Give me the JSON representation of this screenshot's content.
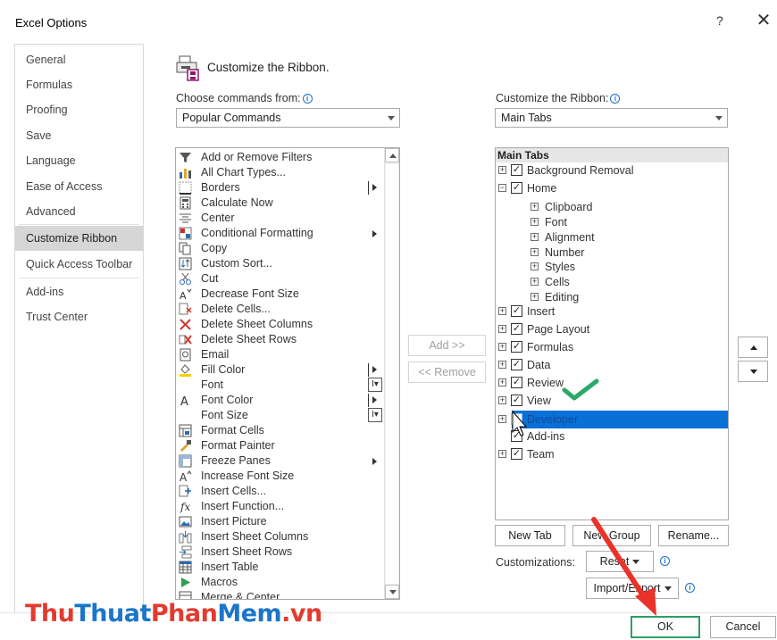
{
  "window": {
    "title": "Excel Options",
    "help": "?",
    "close": "✕"
  },
  "nav": {
    "items": [
      "General",
      "Formulas",
      "Proofing",
      "Save",
      "Language",
      "Ease of Access",
      "Advanced",
      "Customize Ribbon",
      "Quick Access Toolbar",
      "Add-ins",
      "Trust Center"
    ],
    "active": "Customize Ribbon"
  },
  "main": {
    "header": "Customize the Ribbon.",
    "choose_label": "Choose commands from:",
    "choose_value": "Popular Commands",
    "customize_label": "Customize the Ribbon:",
    "customize_value": "Main Tabs"
  },
  "commands": [
    "Add or Remove Filters",
    "All Chart Types...",
    "Borders",
    "Calculate Now",
    "Center",
    "Conditional Formatting",
    "Copy",
    "Custom Sort...",
    "Cut",
    "Decrease Font Size",
    "Delete Cells...",
    "Delete Sheet Columns",
    "Delete Sheet Rows",
    "Email",
    "Fill Color",
    "Font",
    "Font Color",
    "Font Size",
    "Format Cells",
    "Format Painter",
    "Freeze Panes",
    "Increase Font Size",
    "Insert Cells...",
    "Insert Function...",
    "Insert Picture",
    "Insert Sheet Columns",
    "Insert Sheet Rows",
    "Insert Table",
    "Macros",
    "Merge & Center"
  ],
  "buttons": {
    "add": "Add >>",
    "remove": "<< Remove",
    "new_tab": "New Tab",
    "new_group": "New Group",
    "rename": "Rename...",
    "customizations_label": "Customizations:",
    "reset": "Reset",
    "import_export": "Import/Export",
    "ok": "OK",
    "cancel": "Cancel"
  },
  "tree": {
    "header": "Main Tabs",
    "items": [
      {
        "label": "Background Removal",
        "level": 0,
        "exp": "+",
        "checked": true
      },
      {
        "label": "Home",
        "level": 0,
        "exp": "−",
        "checked": true
      },
      {
        "label": "Clipboard",
        "level": 1,
        "exp": "+"
      },
      {
        "label": "Font",
        "level": 1,
        "exp": "+"
      },
      {
        "label": "Alignment",
        "level": 1,
        "exp": "+"
      },
      {
        "label": "Number",
        "level": 1,
        "exp": "+"
      },
      {
        "label": "Styles",
        "level": 1,
        "exp": "+"
      },
      {
        "label": "Cells",
        "level": 1,
        "exp": "+"
      },
      {
        "label": "Editing",
        "level": 1,
        "exp": "+"
      },
      {
        "label": "Insert",
        "level": 0,
        "exp": "+",
        "checked": true
      },
      {
        "label": "Page Layout",
        "level": 0,
        "exp": "+",
        "checked": true
      },
      {
        "label": "Formulas",
        "level": 0,
        "exp": "+",
        "checked": true
      },
      {
        "label": "Data",
        "level": 0,
        "exp": "+",
        "checked": true
      },
      {
        "label": "Review",
        "level": 0,
        "exp": "+",
        "checked": true
      },
      {
        "label": "View",
        "level": 0,
        "exp": "+",
        "checked": true
      },
      {
        "label": "Developer",
        "level": 0,
        "exp": "+",
        "checked": true,
        "selected": true
      },
      {
        "label": "Add-ins",
        "level": 0,
        "exp": "",
        "checked": true
      },
      {
        "label": "Team",
        "level": 0,
        "exp": "+",
        "checked": true
      }
    ]
  },
  "watermark": {
    "p1": "Thu",
    "p2": "Thuat",
    "p3": "Phan",
    "p4": "Mem",
    "p5": ".vn"
  },
  "colors": {
    "selection": "#0a6fd6",
    "ok_border": "#2f9e63",
    "arrow": "#e8322a",
    "check": "#2aa86a"
  }
}
